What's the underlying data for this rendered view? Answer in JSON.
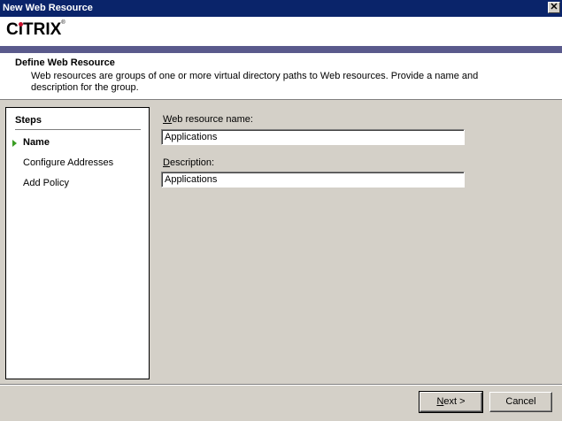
{
  "window": {
    "title": "New Web Resource",
    "close_glyph": "✕"
  },
  "logo": {
    "pre": "C",
    "i_char": "ı",
    "post": "TRIX",
    "reg": "®",
    "accent": "#c8102e"
  },
  "header": {
    "title": "Define Web Resource",
    "description": "Web resources are groups of one or more virtual directory paths to Web resources. Provide a name and description for the group."
  },
  "steps": {
    "title": "Steps",
    "items": [
      {
        "label": "Name",
        "active": true
      },
      {
        "label": "Configure Addresses",
        "active": false
      },
      {
        "label": "Add Policy",
        "active": false
      }
    ]
  },
  "form": {
    "name_label_underlined": "W",
    "name_label_rest": "eb resource name:",
    "name_value": "Applications",
    "desc_label_underlined": "D",
    "desc_label_rest": "escription:",
    "desc_value": "Applications"
  },
  "buttons": {
    "next_underlined": "N",
    "next_rest": "ext >",
    "cancel": "Cancel"
  },
  "colors": {
    "titlebar": "#0a246a",
    "accent_bar": "#5a5a8c",
    "step_arrow": "#3a9d23",
    "dialog_bg": "#d4d0c8"
  }
}
